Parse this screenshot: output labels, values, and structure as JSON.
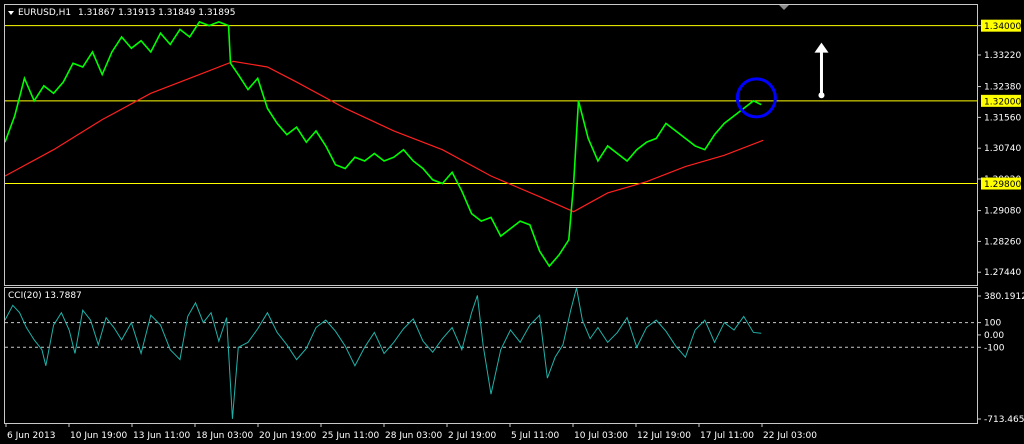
{
  "window": {
    "title": "EURUSD,H1",
    "ohlc": "1.31867 1.31913 1.31849 1.31895",
    "menu_icon": "triangle-down-icon",
    "scroll_marker_icon": "triangle-down-icon"
  },
  "colors": {
    "background": "#000000",
    "frame": "#c8c8c8",
    "price_line": "#00ff00",
    "ma_line": "#ff2020",
    "level_line": "#ffff00",
    "level_label_bg": "#ffff00",
    "cci_line": "#20b2aa",
    "circle": "#0000ff",
    "arrow": "#ffffff",
    "text": "#ffffff"
  },
  "chart_data": [
    {
      "type": "line",
      "yticks": [
        "1.34000",
        "1.33220",
        "1.32380",
        "1.31560",
        "1.30740",
        "1.29920",
        "1.29080",
        "1.28260",
        "1.27440"
      ],
      "ylim": [
        1.271,
        1.3455
      ],
      "xlim": [
        0,
        1000
      ],
      "levels": [
        {
          "value": 1.34,
          "label": "1.34000"
        },
        {
          "value": 1.32,
          "label": "1.32000"
        },
        {
          "value": 1.298,
          "label": "1.29800"
        }
      ],
      "series": [
        {
          "role": "price",
          "x": [
            0,
            10,
            20,
            30,
            40,
            50,
            60,
            70,
            80,
            90,
            100,
            110,
            120,
            130,
            140,
            150,
            160,
            170,
            180,
            190,
            200,
            210,
            220,
            230,
            232,
            240,
            250,
            260,
            270,
            280,
            290,
            300,
            310,
            320,
            330,
            340,
            350,
            360,
            370,
            380,
            390,
            400,
            410,
            420,
            430,
            440,
            450,
            460,
            470,
            480,
            490,
            500,
            510,
            520,
            530,
            540,
            550,
            560,
            570,
            580,
            585,
            590,
            600,
            610,
            620,
            630,
            640,
            650,
            660,
            670,
            680,
            690,
            700,
            710,
            720,
            730,
            740,
            750,
            760,
            770,
            778
          ],
          "y": [
            1.309,
            1.316,
            1.326,
            1.32,
            1.324,
            1.322,
            1.325,
            1.33,
            1.329,
            1.333,
            1.327,
            1.333,
            1.337,
            1.334,
            1.336,
            1.333,
            1.338,
            1.335,
            1.339,
            1.337,
            1.341,
            1.34,
            1.341,
            1.34,
            1.33,
            1.327,
            1.323,
            1.326,
            1.318,
            1.314,
            1.311,
            1.313,
            1.309,
            1.312,
            1.308,
            1.303,
            1.302,
            1.305,
            1.304,
            1.306,
            1.304,
            1.305,
            1.307,
            1.304,
            1.302,
            1.299,
            1.298,
            1.301,
            1.296,
            1.29,
            1.288,
            1.289,
            1.284,
            1.286,
            1.288,
            1.287,
            1.28,
            1.276,
            1.279,
            1.283,
            1.298,
            1.32,
            1.31,
            1.304,
            1.308,
            1.306,
            1.304,
            1.307,
            1.309,
            1.31,
            1.314,
            1.312,
            1.31,
            1.308,
            1.307,
            1.311,
            1.314,
            1.316,
            1.318,
            1.32,
            1.319
          ]
        },
        {
          "role": "moving-average",
          "x": [
            0,
            50,
            100,
            150,
            200,
            235,
            270,
            300,
            350,
            400,
            450,
            500,
            550,
            585,
            620,
            660,
            700,
            740,
            780
          ],
          "y": [
            1.3,
            1.307,
            1.315,
            1.322,
            1.327,
            1.3305,
            1.329,
            1.325,
            1.318,
            1.312,
            1.307,
            1.3,
            1.2945,
            1.2905,
            1.2955,
            1.2985,
            1.3025,
            1.3055,
            1.3095
          ]
        }
      ],
      "annotations": [
        {
          "type": "circle",
          "x": 773,
          "y": 1.3208
        },
        {
          "type": "arrow-up",
          "x": 840,
          "y_from": 1.3215,
          "y_to": 1.3355
        }
      ]
    },
    {
      "type": "line",
      "label": "CCI(20) 13.7887",
      "yticks": [
        "380.1912",
        "100",
        "0.00",
        "-100",
        "-713.4653"
      ],
      "ylim": [
        -713.4653,
        380.1912
      ],
      "levels": [
        100,
        -100
      ],
      "series": [
        {
          "role": "cci",
          "x": [
            0,
            8,
            15,
            22,
            30,
            38,
            42,
            50,
            58,
            66,
            72,
            80,
            88,
            96,
            104,
            112,
            120,
            130,
            140,
            150,
            160,
            170,
            180,
            188,
            196,
            204,
            212,
            220,
            228,
            234,
            240,
            250,
            260,
            270,
            280,
            290,
            300,
            310,
            320,
            330,
            340,
            350,
            360,
            370,
            380,
            390,
            400,
            410,
            420,
            430,
            440,
            450,
            460,
            470,
            480,
            486,
            492,
            500,
            510,
            520,
            530,
            540,
            550,
            558,
            566,
            574,
            582,
            588,
            594,
            602,
            610,
            620,
            630,
            640,
            650,
            660,
            670,
            680,
            690,
            700,
            710,
            720,
            730,
            740,
            750,
            760,
            770,
            778
          ],
          "y": [
            120,
            240,
            180,
            60,
            -40,
            -120,
            -250,
            80,
            180,
            40,
            -150,
            200,
            120,
            -80,
            140,
            60,
            -40,
            100,
            -150,
            160,
            80,
            -120,
            -200,
            150,
            260,
            100,
            180,
            -50,
            140,
            -680,
            -100,
            -60,
            50,
            180,
            20,
            -80,
            -200,
            -110,
            60,
            120,
            30,
            -90,
            -250,
            -100,
            20,
            -150,
            -60,
            50,
            130,
            -50,
            -140,
            -30,
            60,
            -120,
            180,
            320,
            -90,
            -480,
            -120,
            40,
            -60,
            80,
            160,
            -350,
            -180,
            -80,
            200,
            380,
            120,
            -30,
            60,
            -60,
            20,
            140,
            -100,
            60,
            120,
            30,
            -90,
            -180,
            40,
            120,
            -60,
            100,
            40,
            150,
            20,
            14
          ]
        }
      ]
    },
    {
      "type": "table",
      "xticks": [
        "6 Jun 2013",
        "10 Jun 19:00",
        "13 Jun 11:00",
        "18 Jun 03:00",
        "20 Jun 19:00",
        "25 Jun 11:00",
        "28 Jun 03:00",
        "2 Jul 19:00",
        "5 Jul 11:00",
        "10 Jul 03:00",
        "12 Jul 19:00",
        "17 Jul 11:00",
        "22 Jul 03:00"
      ]
    }
  ]
}
